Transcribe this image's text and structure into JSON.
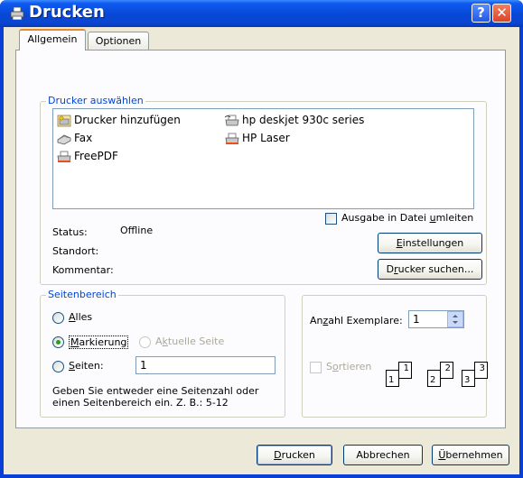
{
  "window": {
    "title": "Drucken",
    "help_glyph": "?",
    "close_glyph": "✕"
  },
  "tabs": [
    {
      "label": "Allgemein",
      "active": true
    },
    {
      "label": "Optionen",
      "active": false
    }
  ],
  "printer_select": {
    "group_label": "Drucker auswählen",
    "printers": [
      {
        "name": "Drucker hinzufügen",
        "icon": "add-printer-icon"
      },
      {
        "name": "Fax",
        "icon": "fax-icon"
      },
      {
        "name": "FreePDF",
        "icon": "printer-icon"
      },
      {
        "name": "hp deskjet 930c series",
        "icon": "default-printer-icon",
        "selected": true
      },
      {
        "name": "HP Laser",
        "icon": "printer-icon"
      }
    ],
    "status_label": "Status:",
    "status_value": "Offline",
    "location_label": "Standort:",
    "comment_label": "Kommentar:",
    "print_to_file_pre": "Ausgabe in Datei ",
    "print_to_file_acc": "u",
    "print_to_file_post": "mleiten",
    "settings_acc": "E",
    "settings_post": "instellungen",
    "find_pre": "D",
    "find_acc": "r",
    "find_post": "ucker suchen..."
  },
  "page_range": {
    "group_label": "Seitenbereich",
    "all_acc": "A",
    "all_post": "lles",
    "selection_acc": "M",
    "selection_post": "arkierung",
    "current_pre": "A",
    "current_acc": "k",
    "current_post": "tuelle Seite",
    "pages_acc": "S",
    "pages_post": "eiten:",
    "pages_value": "1",
    "hint_line1": "Geben Sie entweder eine Seitenzahl oder",
    "hint_line2": "einen Seitenbereich ein. Z. B.: 5-12",
    "selected_option": "Markierung"
  },
  "copies": {
    "label_pre": "An",
    "label_acc": "z",
    "label_post": "ahl Exemplare:",
    "value": "1",
    "collate_acc": "o",
    "collate_pre": "S",
    "collate_post": "rtieren",
    "collate_pages": [
      "1",
      "1",
      "2",
      "2",
      "3",
      "3"
    ]
  },
  "buttons": {
    "print_acc": "D",
    "print_post": "rucken",
    "cancel": "Abbrechen",
    "apply_acc": "Ü",
    "apply_post": "bernehmen"
  }
}
